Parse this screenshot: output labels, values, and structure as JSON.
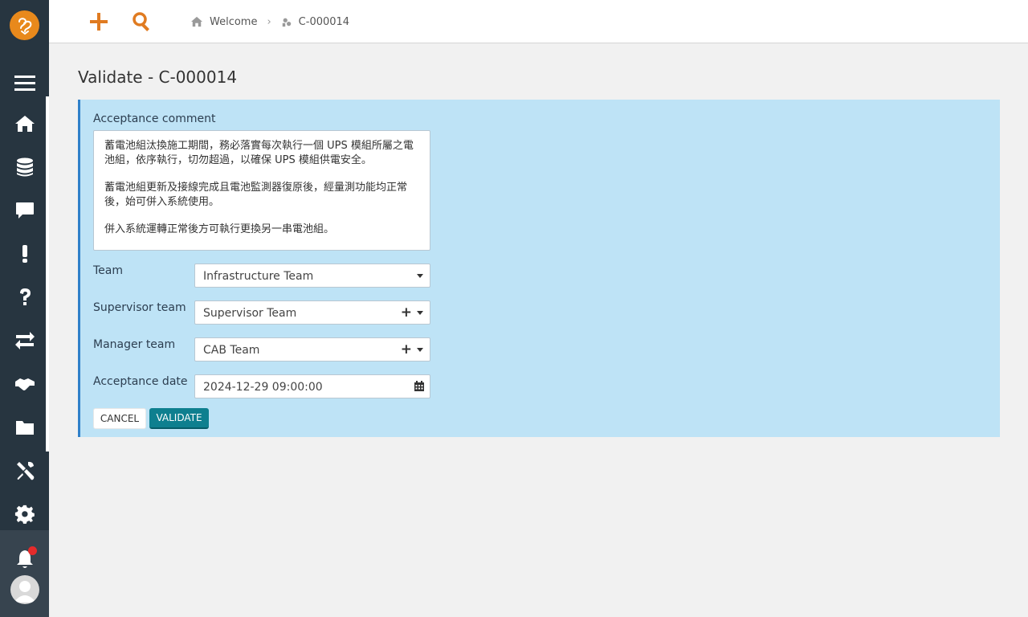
{
  "breadcrumb": {
    "home": "Welcome",
    "current": "C-000014"
  },
  "page": {
    "title": "Validate - C-000014"
  },
  "form": {
    "comment_label": "Acceptance comment",
    "comment_paragraphs": [
      "蓄電池組汰換施工期間，務必落實每次執行一個 UPS 模組所屬之電池組，依序執行，切勿超過，以確保 UPS 模組供電安全。",
      "蓄電池組更新及接線完成且電池監測器復原後，經量測功能均正常後，始可併入系統使用。",
      "併入系統運轉正常後方可執行更換另一串電池組。"
    ],
    "team_label": "Team",
    "team_value": "Infrastructure Team",
    "supervisor_label": "Supervisor team",
    "supervisor_value": "Supervisor Team",
    "manager_label": "Manager team",
    "manager_value": "CAB Team",
    "date_label": "Acceptance date",
    "date_value": "2024-12-29 09:00:00",
    "cancel_label": "CANCEL",
    "validate_label": "VALIDATE"
  },
  "colors": {
    "accent_orange": "#e8891c",
    "sidebar": "#273540",
    "panel_bg": "#bee3f6",
    "validate_button": "#0e7f8f"
  },
  "icons": [
    "logo-icon",
    "menu-icon",
    "home-icon",
    "database-icon",
    "chat-icon",
    "exclamation-icon",
    "question-icon",
    "exchange-icon",
    "handshake-icon",
    "folder-icon",
    "tools-icon",
    "gear-icon",
    "bell-icon",
    "avatar-icon",
    "plus-icon",
    "search-icon",
    "calendar-icon"
  ]
}
